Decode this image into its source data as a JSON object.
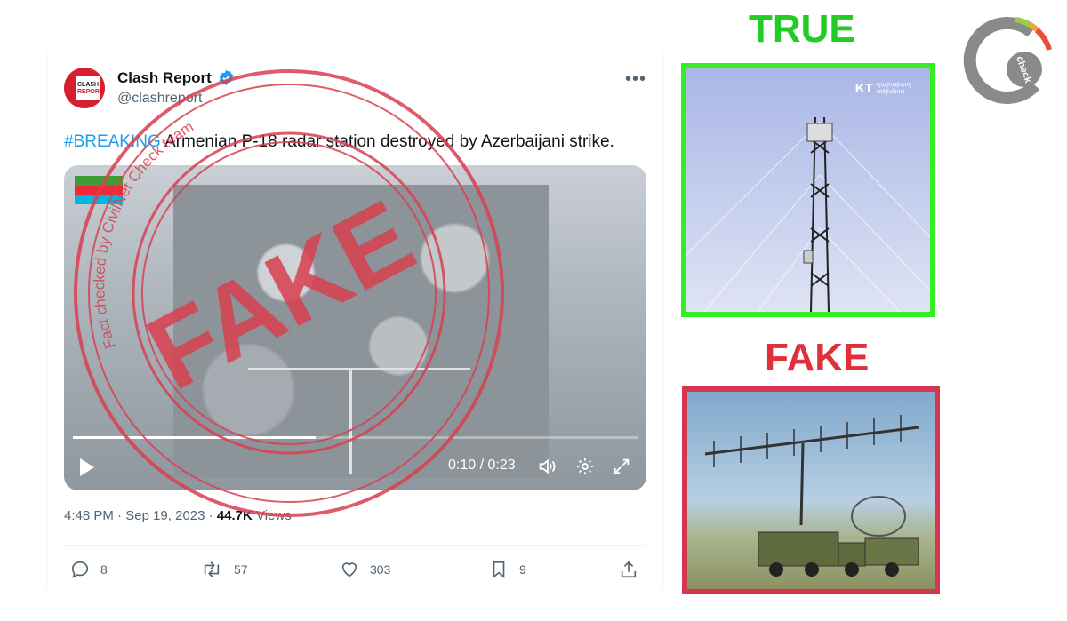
{
  "tweet": {
    "avatar_line1": "CLASH",
    "avatar_line2": "REPORT",
    "name": "Clash Report",
    "handle": "@clashreport",
    "more": "•••",
    "hashtag": "#BREAKING",
    "text": " Armenian P-18 radar station destroyed by Azerbaijani strike.",
    "video": {
      "current_time": "0:10",
      "duration": "0:23",
      "time_display": "0:10 / 0:23",
      "progress_fraction": 0.43
    },
    "meta": {
      "time": "4:48 PM",
      "date": "Sep 19, 2023",
      "views_count": "44.7K",
      "views_label": "Views",
      "sep": " · "
    },
    "actions": {
      "replies": "8",
      "reposts": "57",
      "likes": "303",
      "bookmarks": "9"
    }
  },
  "stamp": {
    "word": "FAKE",
    "ring_text": "Fact checked by CivilNet Check team",
    "color": "#d94050"
  },
  "verdicts": {
    "true_label": "TRUE",
    "fake_label": "FAKE",
    "true_color": "#22cc22",
    "fake_color": "#e0303a"
  },
  "true_image": {
    "watermark": "KT",
    "watermark_sub1": "ղարաբաղ",
    "watermark_sub2": "տեխնոս"
  },
  "logo": {
    "text": "check"
  }
}
